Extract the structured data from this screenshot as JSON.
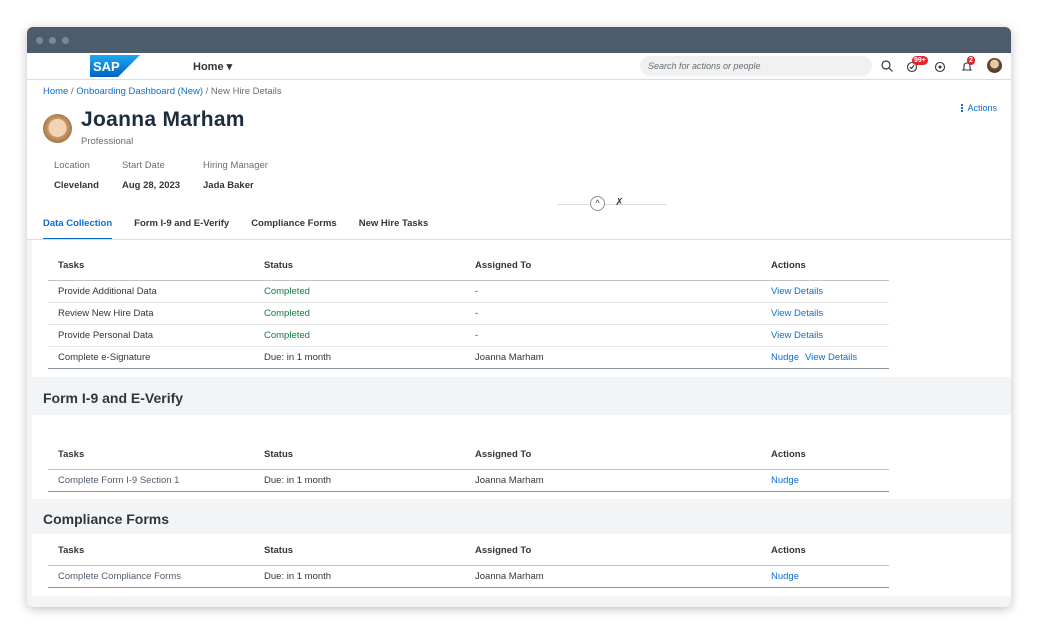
{
  "shell": {
    "home_label": "Home ▾",
    "search_placeholder": "Search for actions or people",
    "notifications_badge": "99+",
    "bell_badge": "2"
  },
  "breadcrumb": {
    "home": "Home",
    "dashboard": "Onboarding Dashboard (New)",
    "current": "New Hire Details",
    "separator": " / "
  },
  "header": {
    "name": "Joanna Marham",
    "role": "Professional",
    "actions_label": "Actions",
    "attributes": [
      {
        "label": "Location",
        "value": "Cleveland"
      },
      {
        "label": "Start Date",
        "value": "Aug 28, 2023"
      },
      {
        "label": "Hiring Manager",
        "value": "Jada Baker"
      }
    ]
  },
  "tabs": [
    {
      "label": "Data Collection",
      "active": true
    },
    {
      "label": "Form I-9 and E-Verify",
      "active": false
    },
    {
      "label": "Compliance Forms",
      "active": false
    },
    {
      "label": "New Hire Tasks",
      "active": false
    }
  ],
  "columns": {
    "tasks": "Tasks",
    "status": "Status",
    "assigned": "Assigned To",
    "actions": "Actions"
  },
  "data_collection": {
    "rows": [
      {
        "task": "Provide Additional Data",
        "status": "Completed",
        "assigned": "-",
        "action1": "View Details",
        "action2": ""
      },
      {
        "task": "Review New Hire Data",
        "status": "Completed",
        "assigned": "-",
        "action1": "View Details",
        "action2": ""
      },
      {
        "task": "Provide Personal Data",
        "status": "Completed",
        "assigned": "-",
        "action1": "View Details",
        "action2": ""
      },
      {
        "task": "Complete e-Signature",
        "status": "Due: in 1 month",
        "assigned": "Joanna Marham",
        "action1": "Nudge",
        "action2": "View Details"
      }
    ]
  },
  "form_i9": {
    "title": "Form I-9 and E-Verify",
    "rows": [
      {
        "task": "Complete Form I-9 Section 1",
        "status": "Due: in 1 month",
        "assigned": "Joanna Marham",
        "action1": "Nudge"
      }
    ]
  },
  "compliance": {
    "title": "Compliance Forms",
    "rows": [
      {
        "task": "Complete Compliance Forms",
        "status": "Due: in 1 month",
        "assigned": "Joanna Marham",
        "action1": "Nudge"
      }
    ]
  },
  "colors": {
    "accent": "#0a6ed1",
    "success": "#107e3e",
    "titlebar": "#4d5c6c",
    "badge": "#e0262b"
  }
}
